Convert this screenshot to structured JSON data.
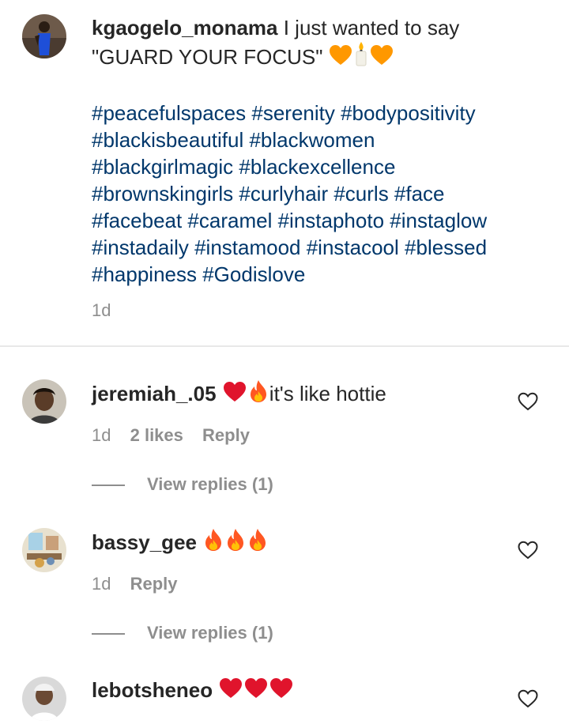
{
  "caption": {
    "username": "kgaogelo_monama",
    "text_part1": " I just wanted to say",
    "text_part2": "\"GUARD YOUR FOCUS\"",
    "emojis": [
      "orange-heart",
      "candle",
      "orange-heart"
    ],
    "hashtag_lines": [
      "#peacefulspaces #serenity #bodypositivity",
      "#blackisbeautiful #blackwomen",
      "#blackgirlmagic #blackexcellence",
      "#brownskingirls #curlyhair #curls #face",
      "#facebeat #caramel #instaphoto #instaglow",
      "#instadaily #instamood #instacool #blessed",
      "#happiness #Godislove"
    ],
    "time": "1d"
  },
  "comments": [
    {
      "username": "jeremiah_.05",
      "emojis": [
        "red-heart",
        "fire"
      ],
      "text": "it's like hottie",
      "time": "1d",
      "likes": "2 likes",
      "reply": "Reply",
      "view_replies": "View replies (1)"
    },
    {
      "username": "bassy_gee",
      "emojis": [
        "fire",
        "fire",
        "fire"
      ],
      "text": "",
      "time": "1d",
      "reply": "Reply",
      "view_replies": "View replies (1)"
    },
    {
      "username": "lebotsheneo",
      "emojis": [
        "red-heart",
        "red-heart",
        "red-heart"
      ],
      "text": ""
    }
  ],
  "colors": {
    "username": "#262626",
    "hashtag": "#00376b",
    "meta": "#8e8e8e",
    "heart_red": "#e0142c",
    "heart_orange": "#ff9800",
    "fire": "#ff5722"
  }
}
